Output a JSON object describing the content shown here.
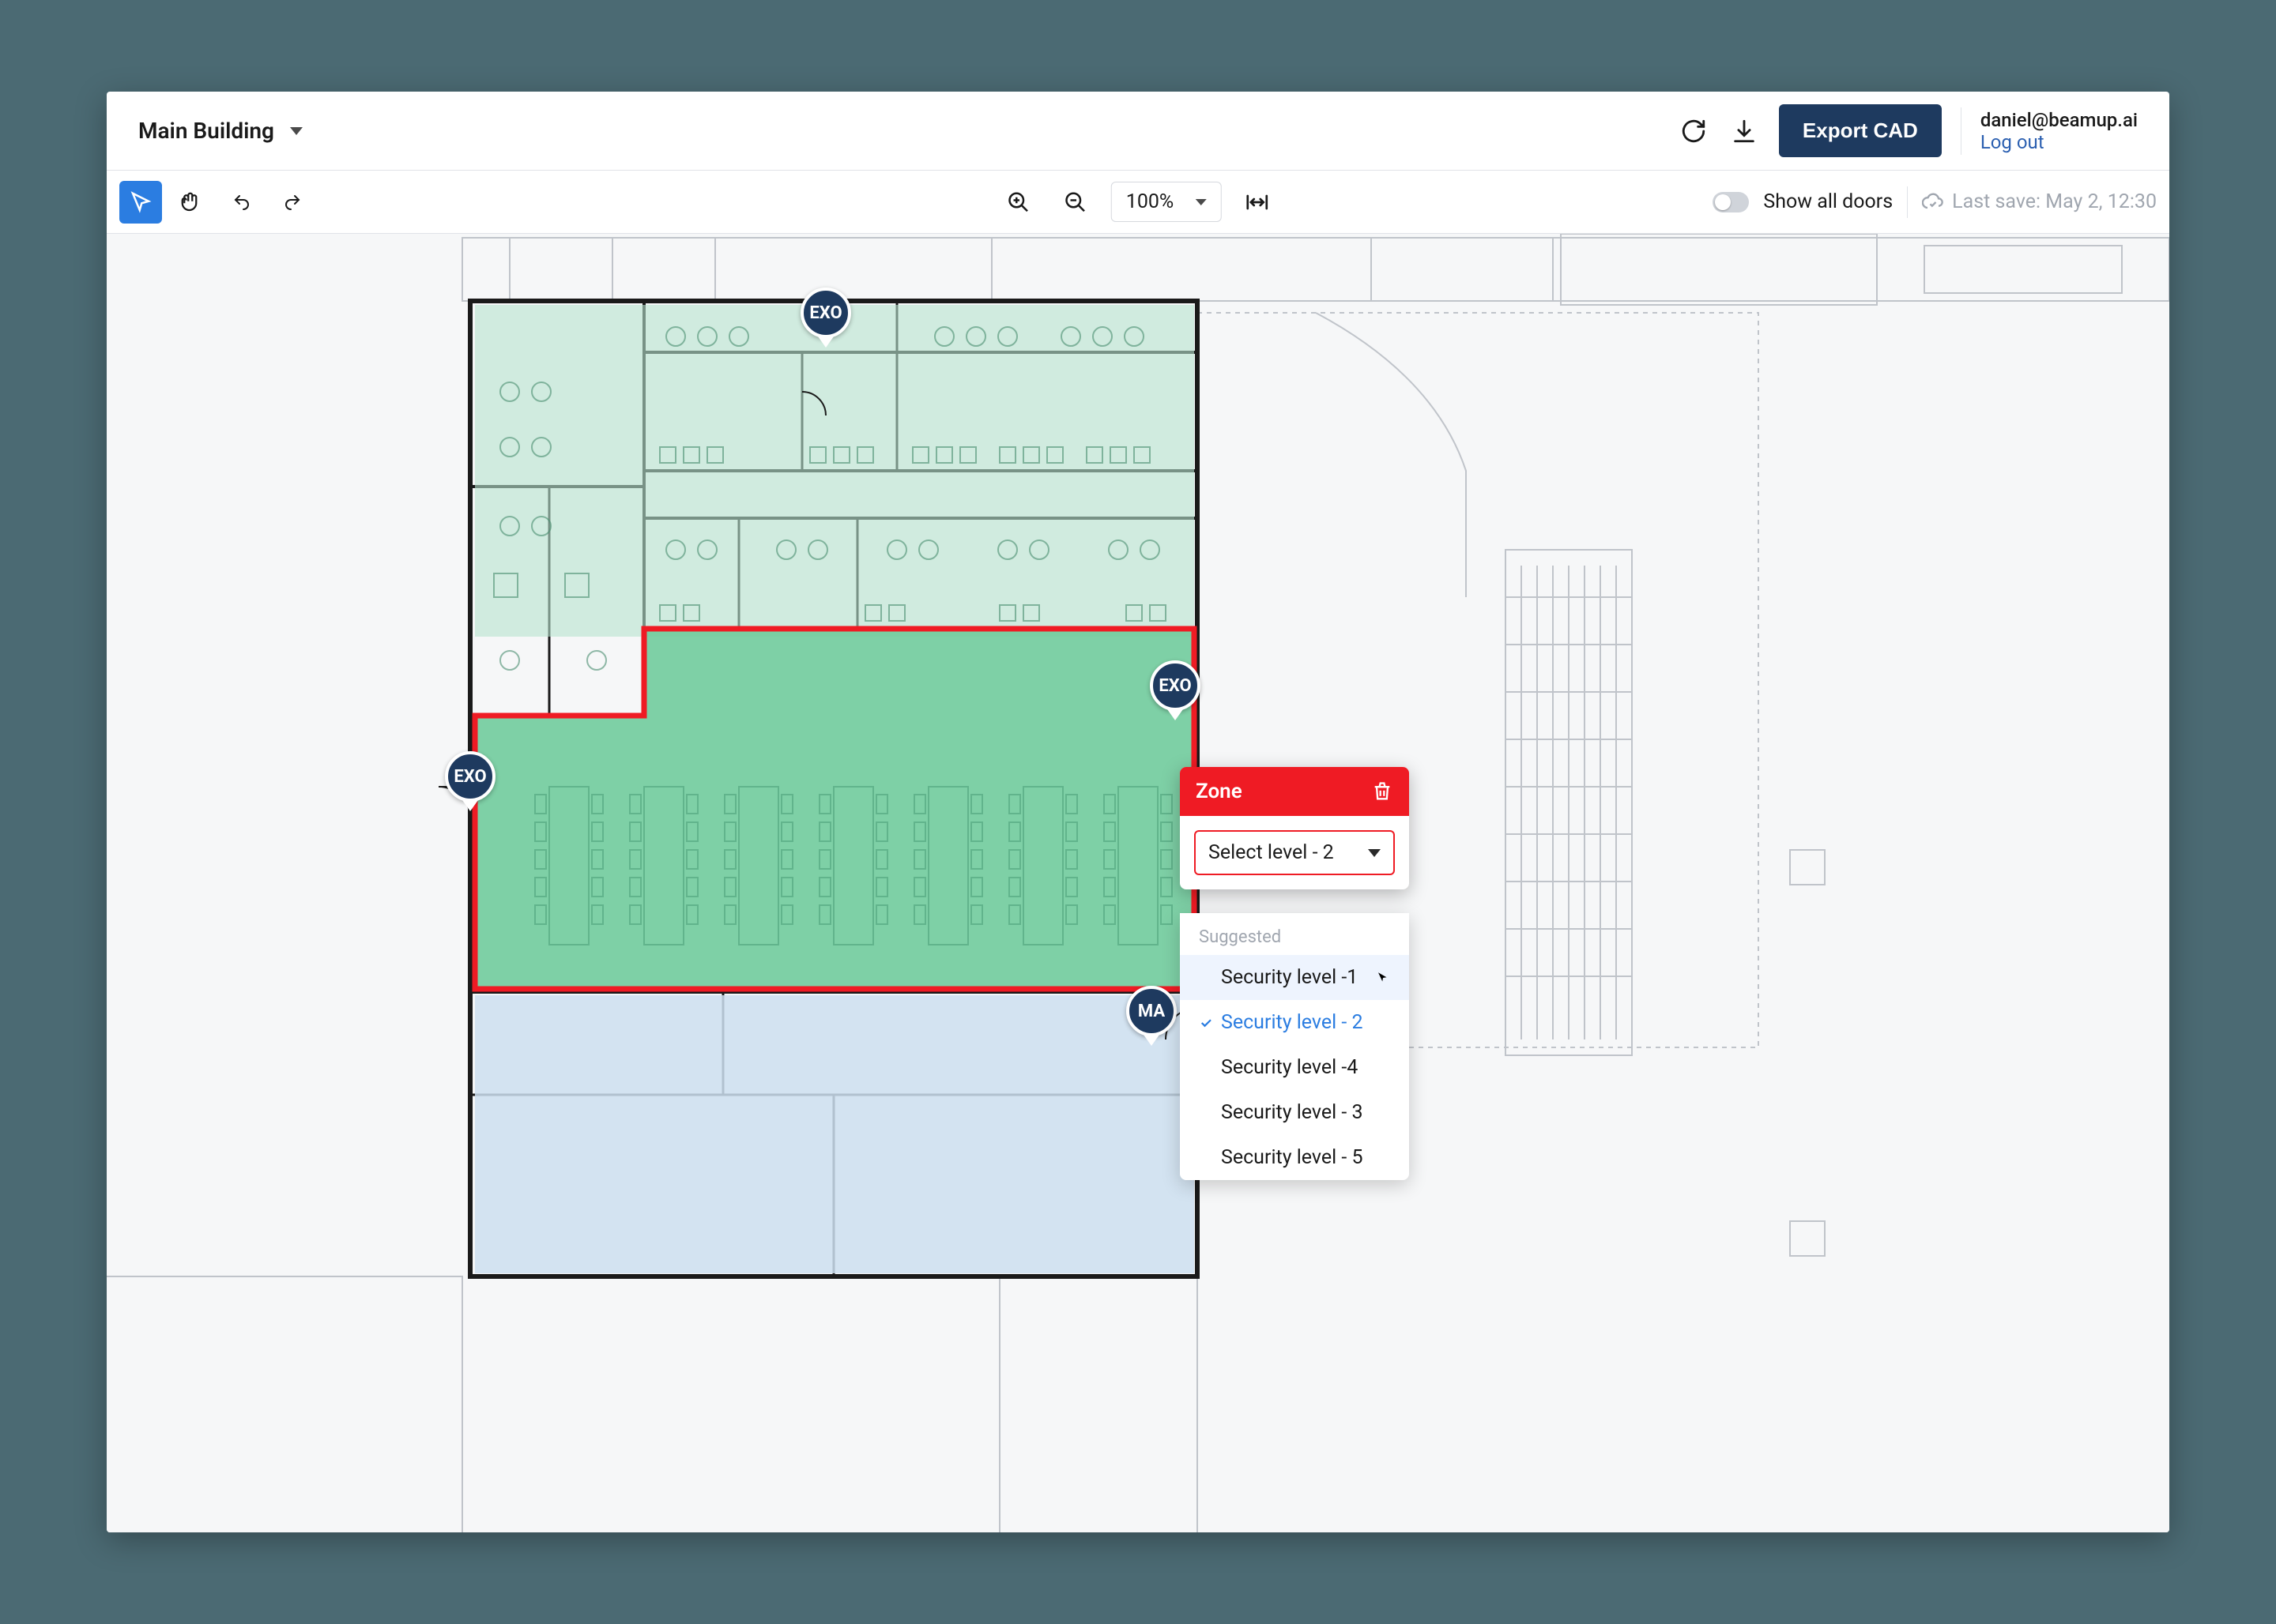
{
  "header": {
    "building_name": "Main Building",
    "export_label": "Export CAD",
    "user_email": "daniel@beamup.ai",
    "logout_label": "Log out"
  },
  "toolbar": {
    "zoom_value": "100%",
    "show_doors_label": "Show all doors",
    "last_save_label": "Last save: May 2, 12:30"
  },
  "floorplan": {
    "tags": {
      "exo1": "EXO",
      "exo2": "EXO",
      "exo3": "EXO",
      "ma": "MA"
    }
  },
  "zone_popup": {
    "title": "Zone",
    "select_label": "Select level - 2"
  },
  "dropdown": {
    "suggested_label": "Suggested",
    "options": {
      "opt1": "Security level -1",
      "opt2": "Security level - 2",
      "opt3": "Security level -4",
      "opt4": "Security level - 3",
      "opt5": "Security level - 5"
    }
  },
  "colors": {
    "primary": "#1e3a5f",
    "accent_red": "#ef1b24",
    "accent_green": "#6dcb9a",
    "accent_green_light": "#b7e3cf",
    "accent_blue_light": "#cddff0",
    "link_blue": "#2b7de1"
  }
}
